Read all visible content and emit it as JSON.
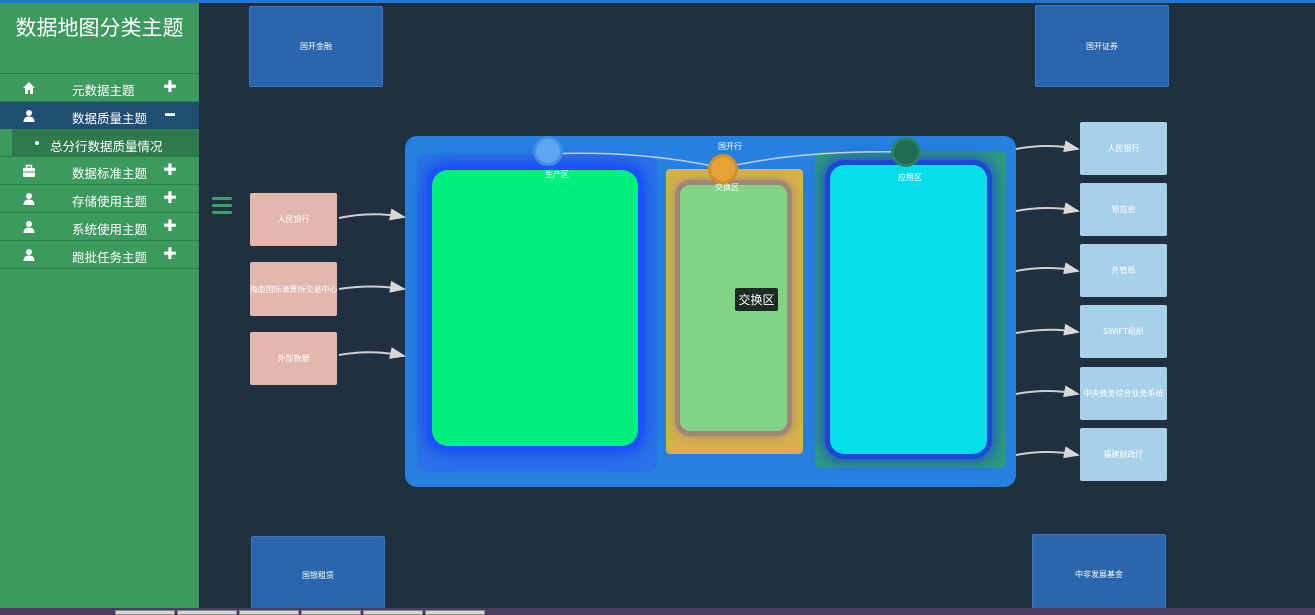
{
  "sidebar": {
    "title": "数据地图分类主题",
    "items": [
      {
        "label": "元数据主题",
        "icon": "home-icon",
        "toggle": "✚",
        "active": false
      },
      {
        "label": "数据质量主题",
        "icon": "user-icon",
        "toggle": "━",
        "active": true
      },
      {
        "label": "数据标准主题",
        "icon": "briefcase-icon",
        "toggle": "✚",
        "active": false
      },
      {
        "label": "存储使用主题",
        "icon": "user-icon",
        "toggle": "✚",
        "active": false
      },
      {
        "label": "系统使用主题",
        "icon": "user-icon",
        "toggle": "✚",
        "active": false
      },
      {
        "label": "跑批任务主题",
        "icon": "user-icon",
        "toggle": "✚",
        "active": false
      }
    ],
    "submenu": {
      "label": "总分行数据质量情况"
    }
  },
  "map": {
    "corners": {
      "top_left": "国开金融",
      "top_right": "国开证券",
      "bottom_left": "国银租赁",
      "bottom_right": "中非发展基金"
    },
    "sources": [
      "人民银行",
      "海南国际清算所交易中心",
      "外部数据"
    ],
    "targets": [
      "人民银行",
      "银监会",
      "外管局",
      "SWIFT组织",
      "中央债务综合业务系统",
      "福建财政厅"
    ],
    "bank_label": "国开行",
    "zones": {
      "production": "生产区",
      "exchange": "交换区",
      "application": "应用区"
    },
    "tooltip": "交换区"
  },
  "colors": {
    "sidebar": "#3c9a5f",
    "active_item": "#1f4e73",
    "background": "#213041",
    "bank": "#2580e0"
  }
}
